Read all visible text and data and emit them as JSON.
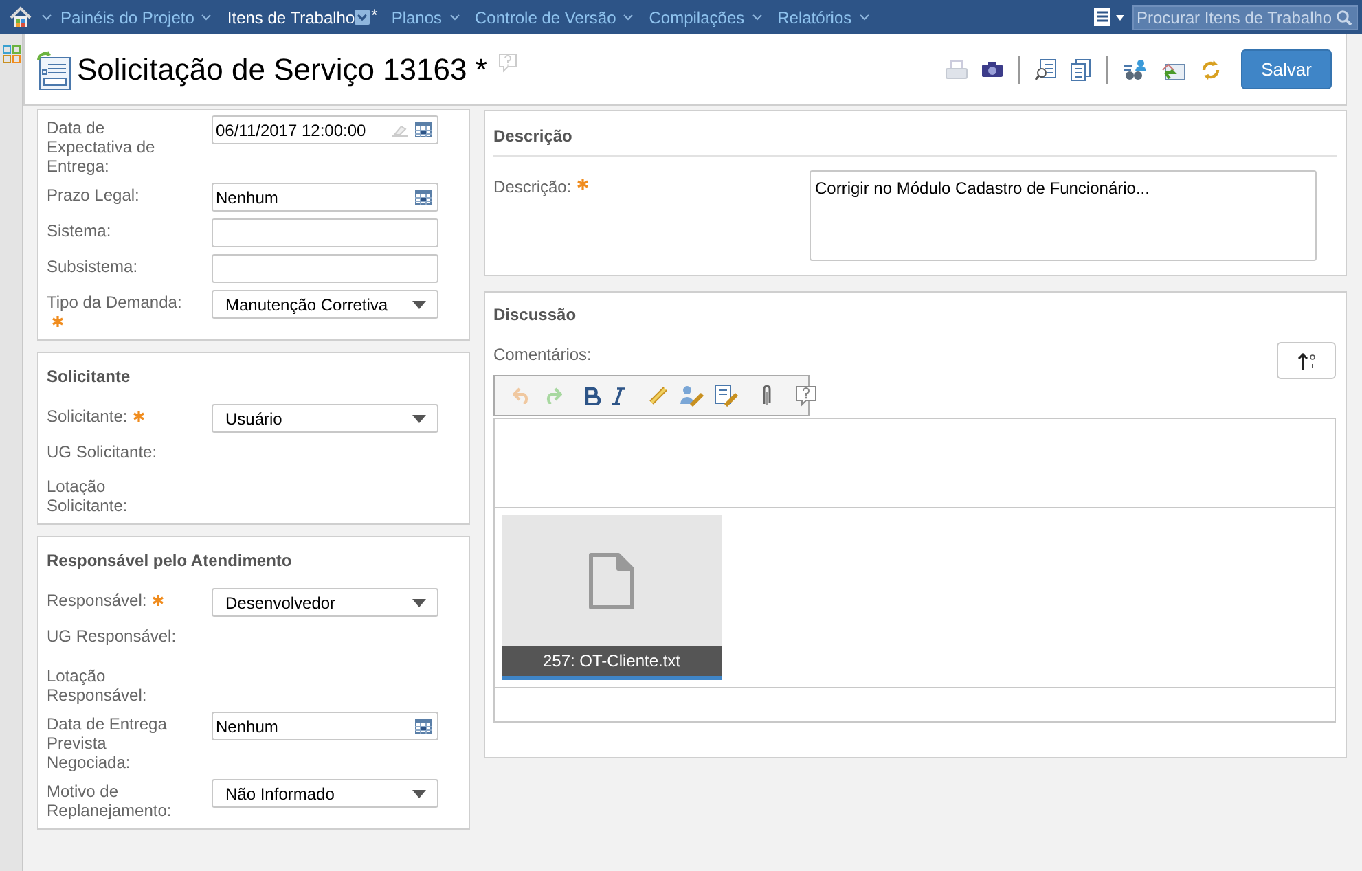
{
  "nav": {
    "items": [
      {
        "label": "Painéis do Projeto",
        "selected": false
      },
      {
        "label": "Itens de Trabalho",
        "selected": true,
        "suffix": "*"
      },
      {
        "label": "Planos",
        "selected": false
      },
      {
        "label": "Controle de Versão",
        "selected": false
      },
      {
        "label": "Compilações",
        "selected": false
      },
      {
        "label": "Relatórios",
        "selected": false
      }
    ],
    "search": {
      "placeholder": "Procurar Itens de Trabalho"
    }
  },
  "header": {
    "title": "Solicitação de Serviço 13163 *",
    "save_button": "Salvar"
  },
  "left_sections": [
    {
      "fields": [
        {
          "label": "Data de Expectativa de Entrega:",
          "required": false,
          "kind": "datetime",
          "value": "06/11/2017 12:00:00"
        },
        {
          "label": "Prazo Legal:",
          "required": false,
          "kind": "date",
          "value": "Nenhum"
        },
        {
          "label": "Sistema:",
          "required": false,
          "kind": "text"
        },
        {
          "label": "Subsistema:",
          "required": false,
          "kind": "text"
        },
        {
          "label": "Tipo da Demanda:",
          "required": true,
          "kind": "select",
          "value": "Manutenção Corretiva"
        }
      ]
    },
    {
      "title": "Solicitante",
      "fields": [
        {
          "label": "Solicitante:",
          "required": true,
          "kind": "select",
          "value": "Usuário"
        },
        {
          "label": "UG Solicitante:",
          "required": false,
          "kind": "none"
        },
        {
          "label": "Lotação Solicitante:",
          "required": false,
          "kind": "none"
        }
      ]
    },
    {
      "title": "Responsável pelo Atendimento",
      "fields": [
        {
          "label": "Responsável:",
          "required": true,
          "kind": "select",
          "value": "Desenvolvedor"
        },
        {
          "label": "UG Responsável:",
          "required": false,
          "kind": "blank"
        },
        {
          "label": "Lotação Responsável:",
          "required": false,
          "kind": "none"
        },
        {
          "label": "Data de Entrega Prevista Negociada:",
          "required": false,
          "kind": "date",
          "value": "Nenhum"
        },
        {
          "label": "Motivo de Replanejamento:",
          "required": false,
          "kind": "select",
          "value": "Não Informado"
        }
      ]
    }
  ],
  "description": {
    "title": "Descrição",
    "label": "Descrição:",
    "required": true,
    "value": "Corrigir no Módulo Cadastro de Funcionário..."
  },
  "discussion": {
    "title": "Discussão",
    "label": "Comentários:",
    "attachment": {
      "caption": "257: OT-Cliente.txt"
    }
  }
}
